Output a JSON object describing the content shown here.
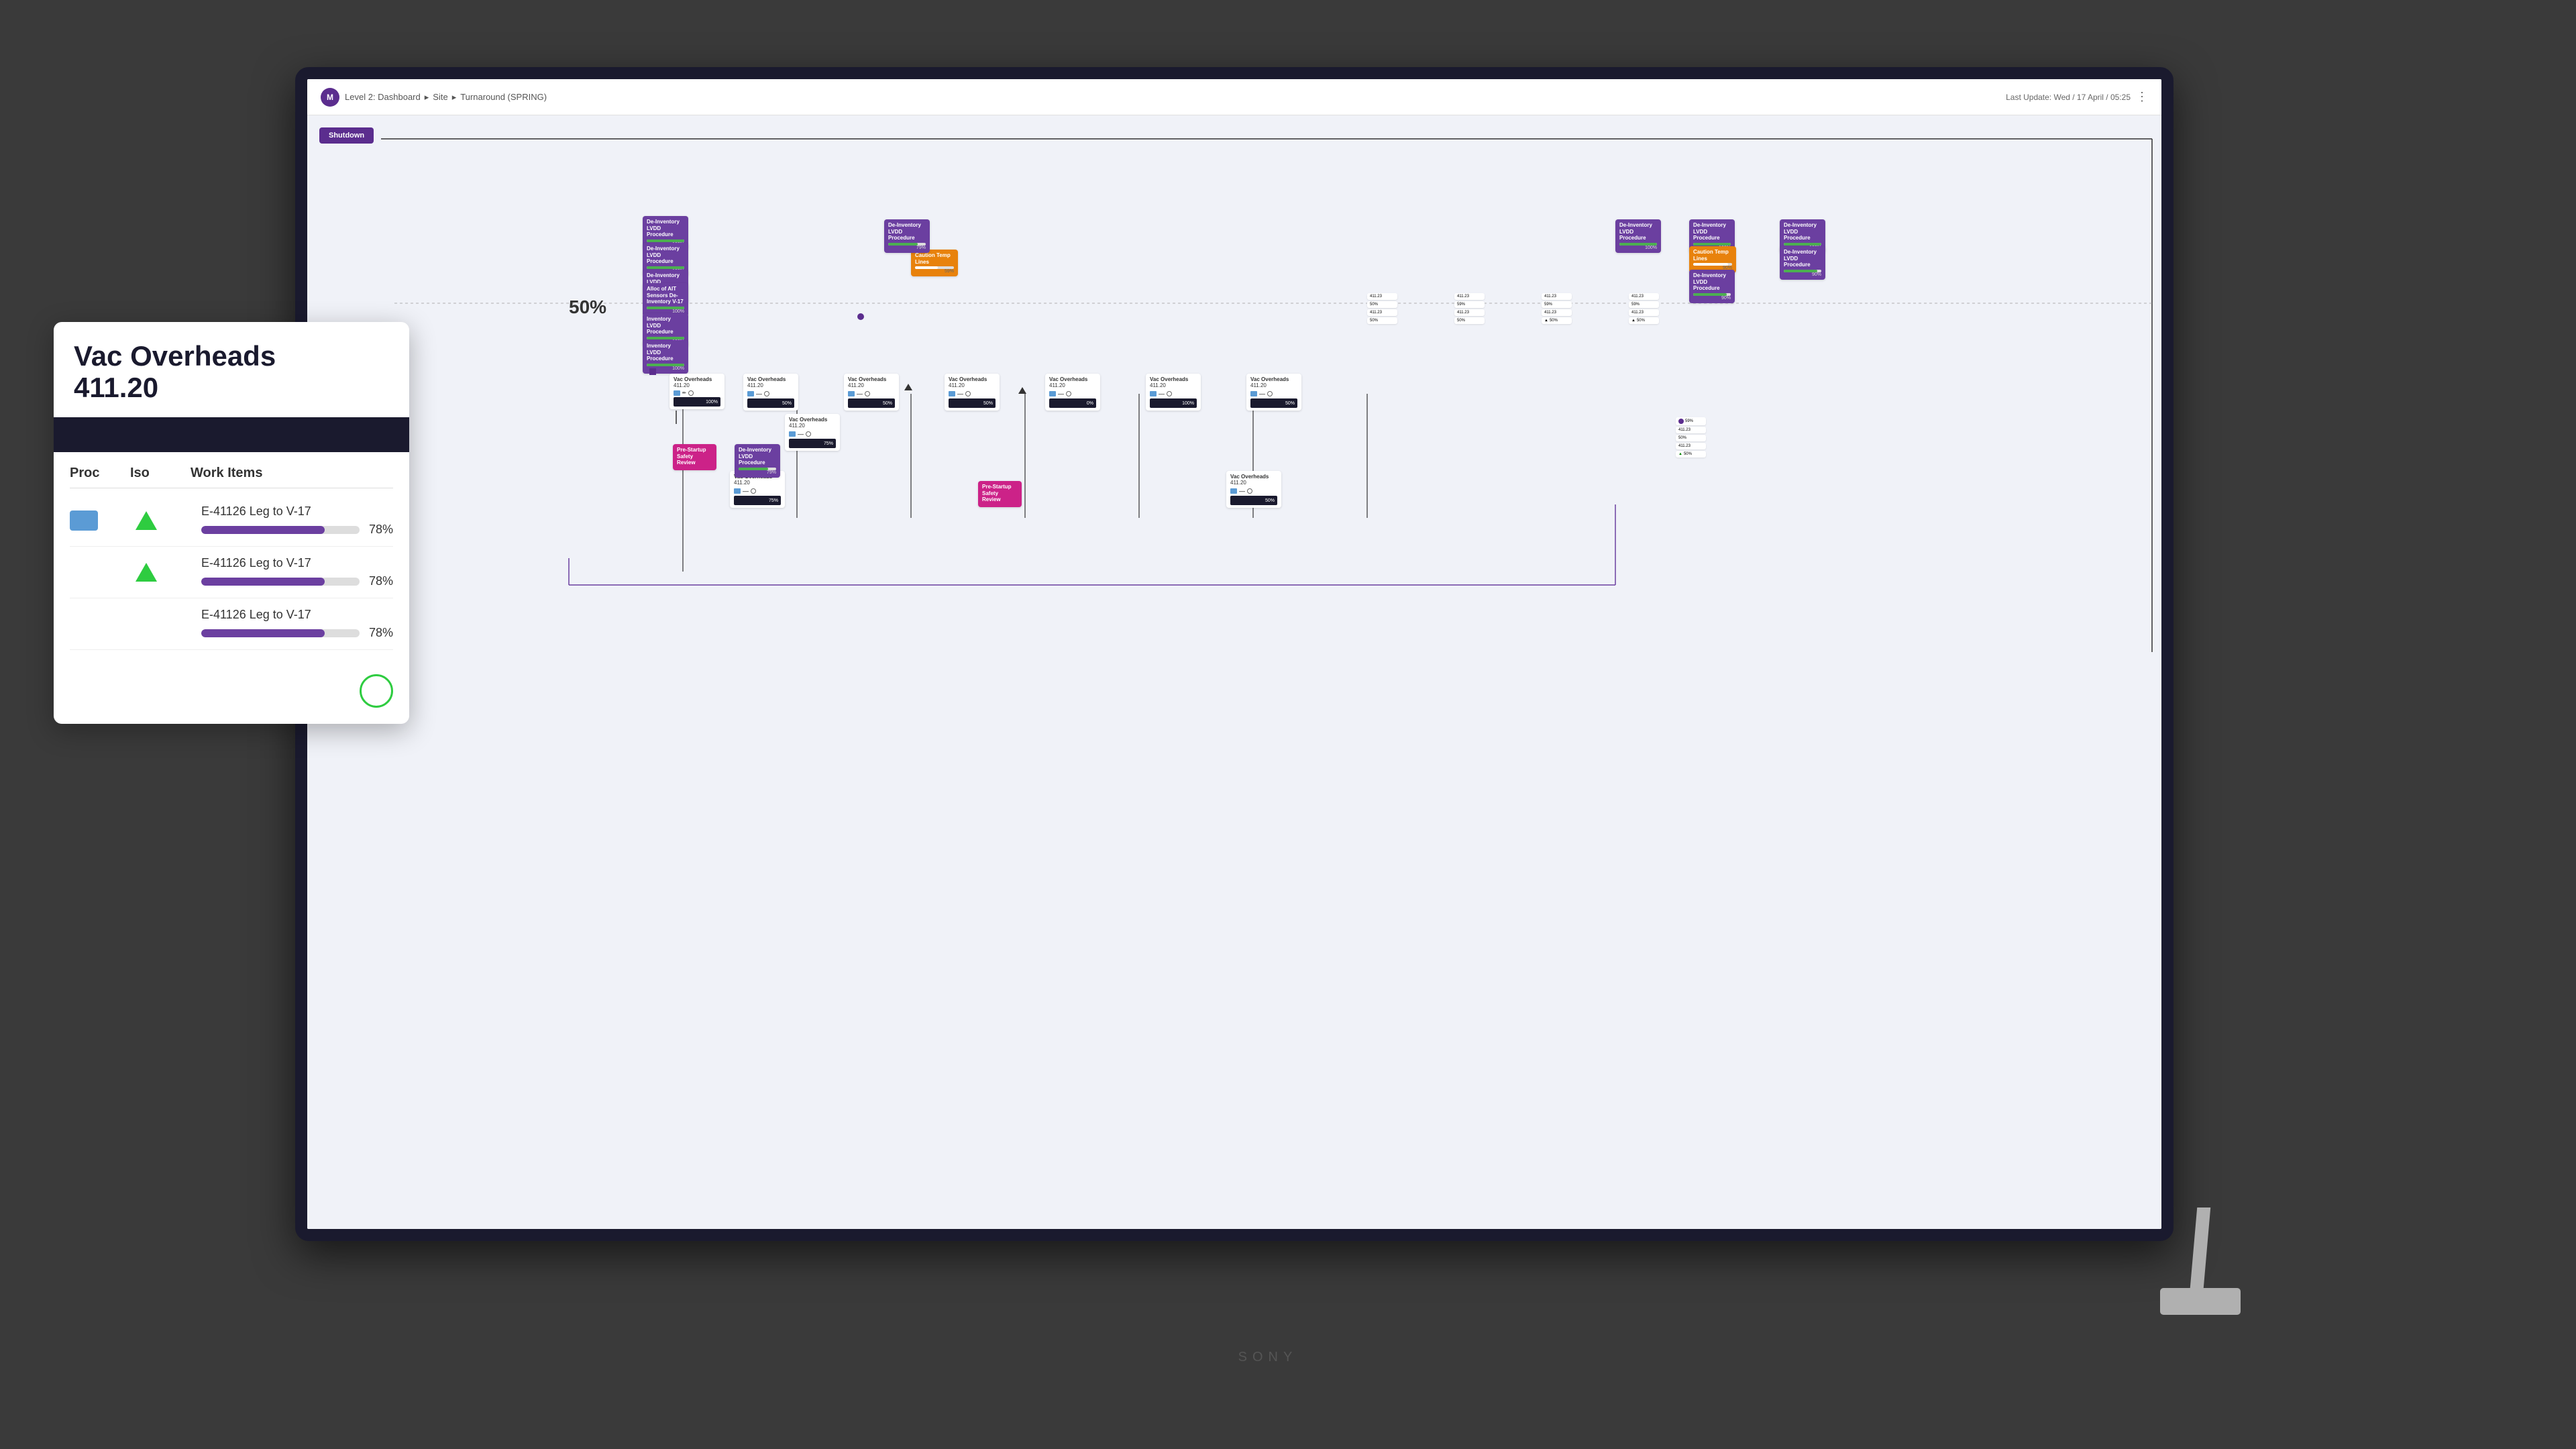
{
  "app": {
    "logo": "M",
    "breadcrumb": {
      "level": "Level 2: Dashboard",
      "sep1": "▸",
      "site": "Site",
      "sep2": "▸",
      "turnaround": "Turnaround (SPRING)"
    },
    "last_update": "Last Update: Wed / 17 April / 05:25",
    "menu_icon": "⋮"
  },
  "popup": {
    "title": "Vac Overheads",
    "id": "411.20",
    "table": {
      "headers": [
        "Proc",
        "Iso",
        "Work Items"
      ],
      "rows": [
        {
          "work_item": "E-41126 Leg to V-17",
          "progress": 78,
          "pct_label": "78%"
        },
        {
          "work_item": "E-41126 Leg to V-17",
          "progress": 78,
          "pct_label": "78%"
        },
        {
          "work_item": "E-41126 Leg to V-17",
          "progress": 78,
          "pct_label": "78%"
        }
      ]
    }
  },
  "diagram": {
    "shutdown_label": "Shutdown",
    "pct_50_label": "50%",
    "sony_brand": "SONY",
    "nodes": {
      "purple_nodes": [
        {
          "label": "De-Inventory LVDD\nProcedure",
          "pct": "100%",
          "fill": 100
        },
        {
          "label": "De-Inventory LVDD\nProcedure",
          "pct": "100%",
          "fill": 100
        },
        {
          "label": "De-Inventory LVDD\nProcedure",
          "pct": "100%",
          "fill": 100
        },
        {
          "label": "De-Inventory LVDD\nProcedure",
          "pct": "75%",
          "fill": 75
        },
        {
          "label": "De-Inventory LVDD\nProcedure",
          "pct": "79%",
          "fill": 79
        },
        {
          "label": "De-Inventory LVDD\nProcedure",
          "pct": "100%",
          "fill": 100
        },
        {
          "label": "De-Inventory LVDD\nProcedure",
          "pct": "90%",
          "fill": 90
        },
        {
          "label": "De-Inventory LVDD\nProcedure",
          "pct": "100%",
          "fill": 100
        },
        {
          "label": "Inventory LVDD\nProcedure",
          "pct": "100%",
          "fill": 100
        },
        {
          "label": "Inventory LVDD\nProcedure",
          "pct": "100%",
          "fill": 100
        },
        {
          "label": "Inventory LVDD\nProcedure",
          "pct": "100%",
          "fill": 100
        }
      ],
      "orange_nodes": [
        {
          "label": "Caution Temp Lines",
          "pct": "96%",
          "fill": 96
        },
        {
          "label": "Caution Temp Lines",
          "pct": "59%",
          "fill": 59
        }
      ],
      "pink_nodes": [
        {
          "label": "Pre-Startup Safety Review"
        },
        {
          "label": "Pre-Startup Safety Review"
        }
      ],
      "vac_cards": [
        {
          "id": "411.20",
          "pct": "100%"
        },
        {
          "id": "411.20",
          "pct": "50%"
        },
        {
          "id": "411.20",
          "pct": "50%"
        },
        {
          "id": "411.20",
          "pct": "50%"
        },
        {
          "id": "411.20",
          "pct": "0%"
        },
        {
          "id": "411.20",
          "pct": "100%"
        },
        {
          "id": "411.20",
          "pct": "50%"
        },
        {
          "id": "411.20",
          "pct": "75%"
        },
        {
          "id": "411.20",
          "pct": "75%"
        },
        {
          "id": "411.20",
          "pct": "50%"
        }
      ]
    }
  },
  "colors": {
    "purple": "#6b3fa0",
    "orange": "#e8820c",
    "pink": "#cc2288",
    "dark": "#1a1a2e",
    "green": "#2ecc40",
    "blue": "#5b9bd5"
  }
}
